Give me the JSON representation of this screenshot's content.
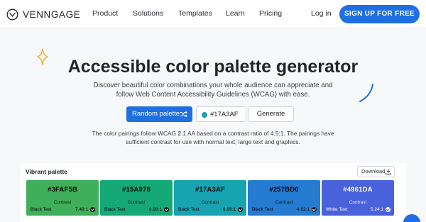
{
  "header": {
    "brand": "VENNGAGE",
    "logo_icon": "venngage-logo-icon",
    "nav": [
      "Product",
      "Solutions",
      "Templates",
      "Learn",
      "Pricing"
    ],
    "login_label": "Log in",
    "signup_label": "SIGN UP FOR FREE"
  },
  "hero": {
    "title": "Accessible color palette generator",
    "subtitle": "Discover beautiful color combinations your whole audience can appreciate and follow Web Content Accessibility Guidelines (WCAG) with ease.",
    "random_label": "Random palette",
    "random_icon": "shuffle-icon",
    "hex_value": "#17A3AF",
    "hex_dot_color": "#17A3AF",
    "generate_label": "Generate",
    "note": "The color pairings follow WCAG 2.1 AA based on a contrast ratio of 4.5:1. The pairings have sufficient contrast for use with normal text, large text and graphics."
  },
  "palette": {
    "name": "Vibrant palette",
    "download_label": "Download",
    "download_icon": "download-icon",
    "swatches": [
      {
        "hex": "#3FAF5B",
        "color": "#3FAF5B",
        "contrast_label": "Contrast",
        "text_label": "Black Text",
        "ratio": "7.49:1"
      },
      {
        "hex": "#15A978",
        "color": "#15A978",
        "contrast_label": "Contrast",
        "text_label": "Black Text",
        "ratio": "6.98:1"
      },
      {
        "hex": "#17A3AF",
        "color": "#17A3AF",
        "contrast_label": "Contrast",
        "text_label": "Black Text",
        "ratio": "6.89:1"
      },
      {
        "hex": "#257BD0",
        "color": "#257BD0",
        "contrast_label": "Contrast",
        "text_label": "Black Text",
        "ratio": "4.62:1"
      },
      {
        "hex": "#4961DA",
        "color": "#4961DA",
        "contrast_label": "Contrast",
        "text_label": "White Text",
        "ratio": "5.24:1"
      }
    ]
  },
  "colors": {
    "accent": "#1F6FE0",
    "sparkle": "#F2B544"
  }
}
